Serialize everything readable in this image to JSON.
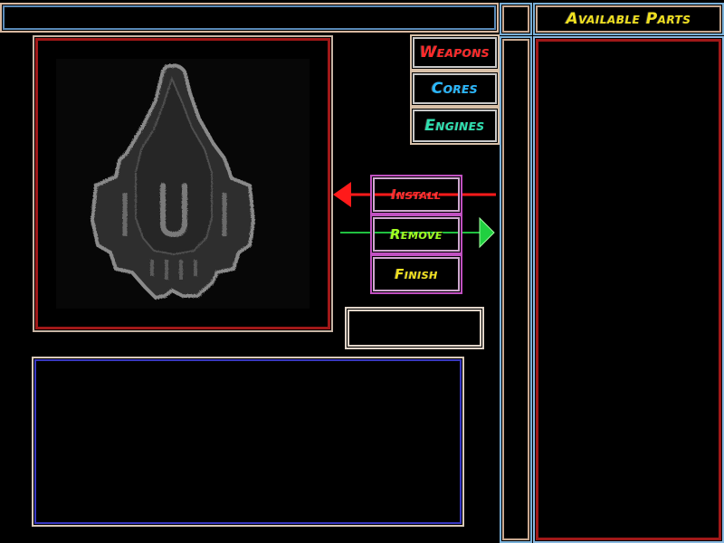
{
  "header": {
    "title": "",
    "right_box": ""
  },
  "parts_panel": {
    "title": "Available Parts",
    "title_color": "#f0e020",
    "items": []
  },
  "tabs": [
    {
      "label": "Weapons",
      "color": "#ff2a2a"
    },
    {
      "label": "Cores",
      "color": "#2ab8ff"
    },
    {
      "label": "Engines",
      "color": "#30e0b0"
    }
  ],
  "actions": [
    {
      "label": "Install",
      "color": "#ff2a2a",
      "arrow": "left-red"
    },
    {
      "label": "Remove",
      "color": "#a0ff20",
      "arrow": "right-green"
    },
    {
      "label": "Finish",
      "color": "#f0e020"
    }
  ],
  "ship_preview": {
    "icon": "spaceship-icon"
  },
  "status_box": {
    "text": ""
  },
  "info_panel": {
    "text": ""
  }
}
